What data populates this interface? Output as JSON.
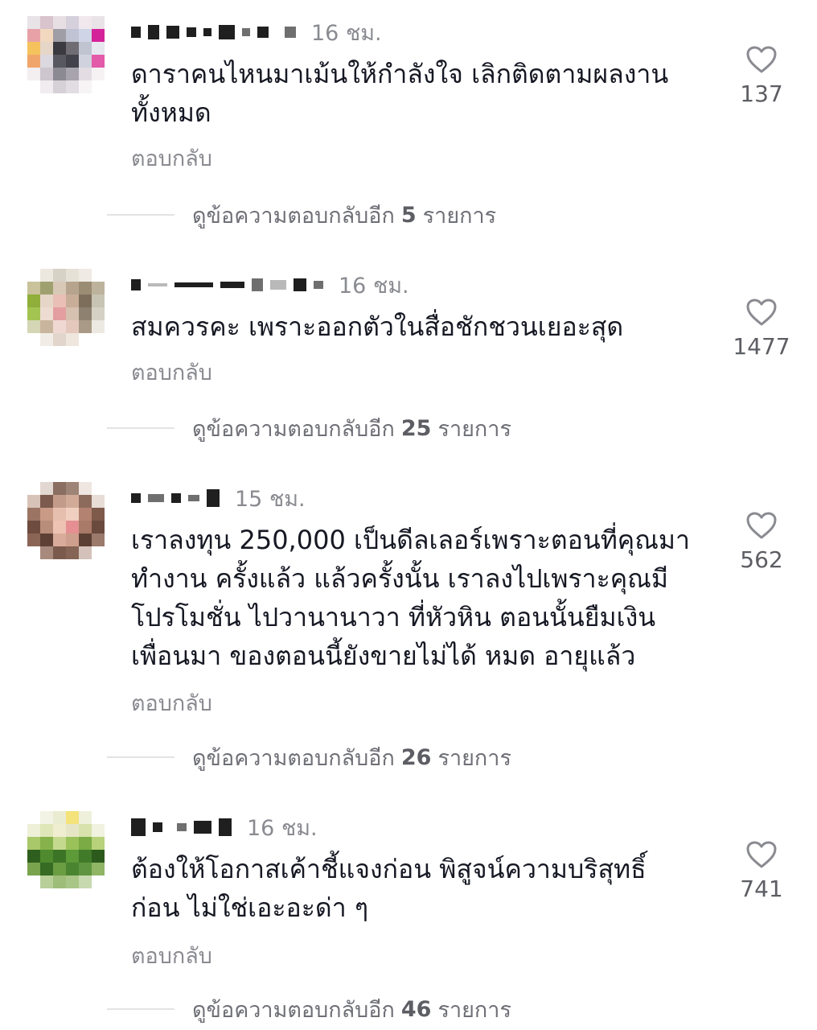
{
  "comments": [
    {
      "time": "16 ชม.",
      "text": "ดาราคนไหนมาเม้นให้กำลังใจ เลิกติดตามผลงาน\nทั้งหมด",
      "reply_label": "ตอบกลับ",
      "likes": "137",
      "more_prefix": "ดูข้อความตอบกลับอีก",
      "more_count": "5",
      "more_suffix": "รายการ"
    },
    {
      "time": "16 ชม.",
      "text": "สมควรคะ เพราะออกตัวในสื่อชักชวนเยอะสุด",
      "reply_label": "ตอบกลับ",
      "likes": "1477",
      "more_prefix": "ดูข้อความตอบกลับอีก",
      "more_count": "25",
      "more_suffix": "รายการ"
    },
    {
      "time": "15 ชม.",
      "text": "เราลงทุน 250,000 เป็นดีลเลอร์เพราะตอนที่คุณมา\nทำงาน ครั้งแล้ว แล้วครั้งนั้น เราลงไปเพราะคุณมี\nโปรโมชั่น ไปวานานาวา ที่หัวหิน ตอนนั้นยืมเงิน\nเพื่อนมา ของตอนนี้ยังขายไม่ได้ หมด อายุแล้ว",
      "reply_label": "ตอบกลับ",
      "likes": "562",
      "more_prefix": "ดูข้อความตอบกลับอีก",
      "more_count": "26",
      "more_suffix": "รายการ"
    },
    {
      "time": "16 ชม.",
      "text": "ต้องให้โอกาสเค้าชี้แจงก่อน พิสูจน์ความบริสุทธิ์\nก่อน ไม่ใช่เอะอะด่า ๆ",
      "reply_label": "ตอบกลับ",
      "likes": "741",
      "more_prefix": "ดูข้อความตอบกลับอีก",
      "more_count": "46",
      "more_suffix": "รายการ"
    }
  ],
  "icons": {
    "like": "heart-outline-icon",
    "avatar": "pixelated-avatar"
  },
  "colors": {
    "text": "#161823",
    "muted": "#8a8b91",
    "divider": "#e3e3e6"
  }
}
